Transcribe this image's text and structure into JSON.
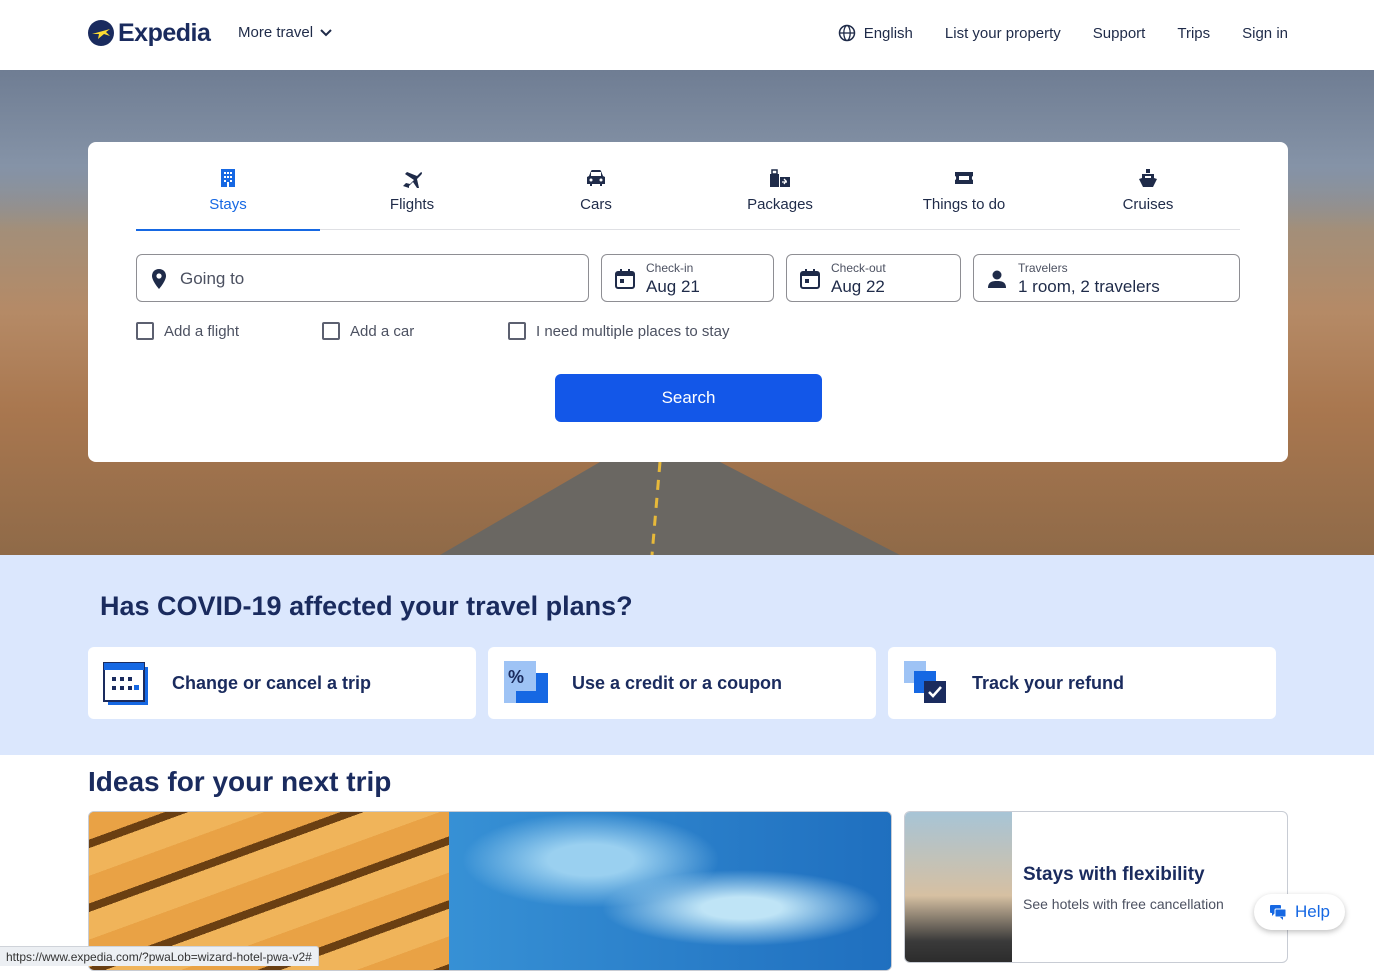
{
  "header": {
    "logo_text": "Expedia",
    "more_travel": "More travel",
    "nav": {
      "language": "English",
      "list_property": "List your property",
      "support": "Support",
      "trips": "Trips",
      "sign_in": "Sign in"
    }
  },
  "search": {
    "tabs": [
      {
        "label": "Stays",
        "icon": "building-icon",
        "active": true
      },
      {
        "label": "Flights",
        "icon": "plane-icon"
      },
      {
        "label": "Cars",
        "icon": "car-icon"
      },
      {
        "label": "Packages",
        "icon": "packages-icon"
      },
      {
        "label": "Things to do",
        "icon": "ticket-icon"
      },
      {
        "label": "Cruises",
        "icon": "ship-icon"
      }
    ],
    "going_to_placeholder": "Going to",
    "checkin_label": "Check-in",
    "checkin_value": "Aug 21",
    "checkout_label": "Check-out",
    "checkout_value": "Aug 22",
    "travelers_label": "Travelers",
    "travelers_value": "1 room, 2 travelers",
    "checks": [
      "Add a flight",
      "Add a car",
      "I need multiple places to stay"
    ],
    "search_button": "Search"
  },
  "covid": {
    "title": "Has COVID-19 affected your travel plans?",
    "cards": [
      "Change or cancel a trip",
      "Use a credit or a coupon",
      "Track your refund"
    ]
  },
  "ideas": {
    "title": "Ideas for your next trip",
    "flex_title": "Stays with flexibility",
    "flex_subtitle": "See hotels with free cancellation"
  },
  "help_label": "Help",
  "status_url": "https://www.expedia.com/?pwaLob=wizard-hotel-pwa-v2#",
  "colors": {
    "primary": "#1668e3",
    "button": "#1357e8",
    "navy": "#1a2b5e",
    "covid_bg": "#dbe7fd"
  }
}
